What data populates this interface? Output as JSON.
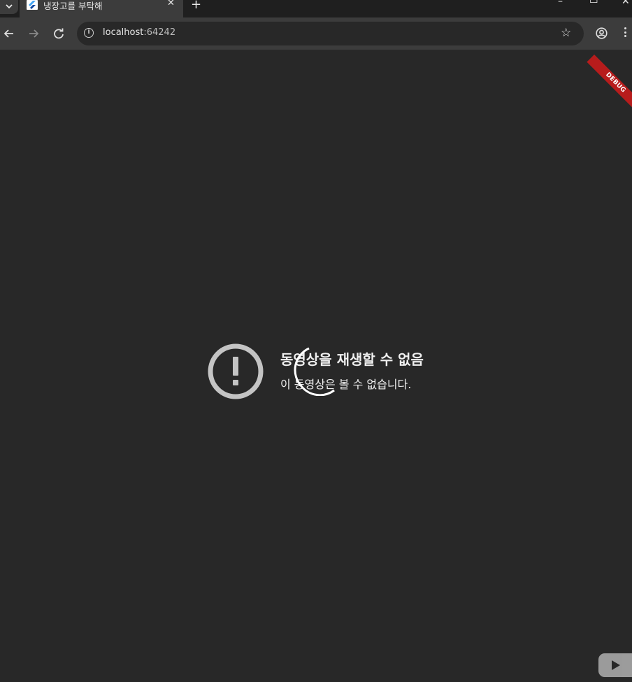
{
  "browser": {
    "tab": {
      "title": "냉장고를 부탁해",
      "close_glyph": "✕",
      "favicon": "flutter-icon"
    },
    "new_tab_glyph": "+",
    "window_controls": {
      "minimize": "–",
      "maximize": "☐",
      "close": "✕"
    },
    "address": {
      "host": "localhost",
      "port": ":64242"
    }
  },
  "app": {
    "debug_banner": "DEBUG",
    "player_error": {
      "title": "동영상을 재생할 수 없음",
      "message": "이 동영상은 볼 수 없습니다.",
      "icon": "alert-circle-icon"
    },
    "loading_indicator": "spinner-icon",
    "brand_logo": "youtube-icon"
  },
  "colors": {
    "page_bg": "#282828",
    "toolbar_bg": "#3c3c3c",
    "tabstrip_bg": "#1f1f1f",
    "error_icon": "#c4c4c4",
    "debug_ribbon": "#b71c1c"
  }
}
